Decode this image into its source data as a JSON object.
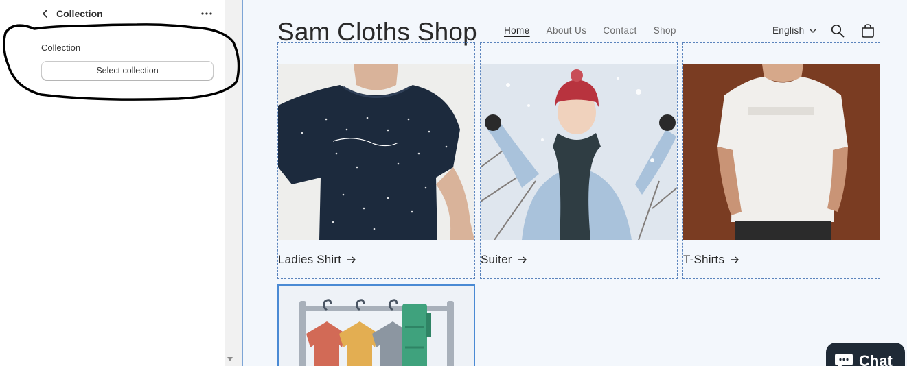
{
  "sidebar": {
    "title": "Collection",
    "setting_label": "Collection",
    "select_button": "Select collection",
    "icons": {
      "back": "chevron-left-icon",
      "more": "more-horizontal-icon"
    }
  },
  "site": {
    "title": "Sam Cloths Shop",
    "nav": [
      {
        "label": "Home",
        "active": true
      },
      {
        "label": "About Us",
        "active": false
      },
      {
        "label": "Contact",
        "active": false
      },
      {
        "label": "Shop",
        "active": false
      }
    ],
    "language": "English",
    "icons": {
      "search": "search-icon",
      "cart": "cart-icon"
    }
  },
  "collections": [
    {
      "label": "Ladies Shirt"
    },
    {
      "label": "Suiter"
    },
    {
      "label": "T-Shirts"
    }
  ],
  "chat": {
    "label": "Chat"
  },
  "colors": {
    "preview_bg": "#f3f7fc",
    "selection_blue": "#4a8ad4",
    "chat_bg": "#1f2a36"
  }
}
